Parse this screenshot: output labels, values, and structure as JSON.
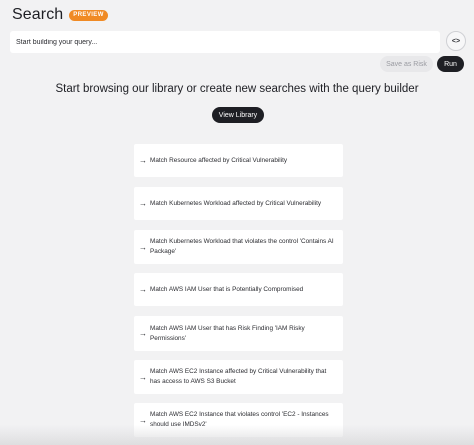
{
  "header": {
    "title": "Search",
    "badge": "PREVIEW"
  },
  "query": {
    "placeholder": "Start building your query...",
    "value": ""
  },
  "toolbar": {
    "code_toggle_label": "<>",
    "save_label": "Save as Risk",
    "run_label": "Run"
  },
  "main": {
    "heading": "Start browsing our library or create new searches with the query builder",
    "view_library_label": "View Library",
    "arrow": "→",
    "suggestions": [
      "Match Resource affected by Critical Vulnerability",
      "Match Kubernetes Workload affected by Critical Vulnerability",
      "Match Kubernetes Workload that violates the control 'Contains AI Package'",
      "Match AWS IAM User that is Potentially Compromised",
      "Match AWS IAM User that has Risk Finding 'IAM Risky Permissions'",
      "Match AWS EC2 Instance affected by Critical Vulnerability that has access to AWS S3 Bucket",
      "Match AWS EC2 Instance that violates control 'EC2 - Instances should use IMDSv2'"
    ]
  }
}
